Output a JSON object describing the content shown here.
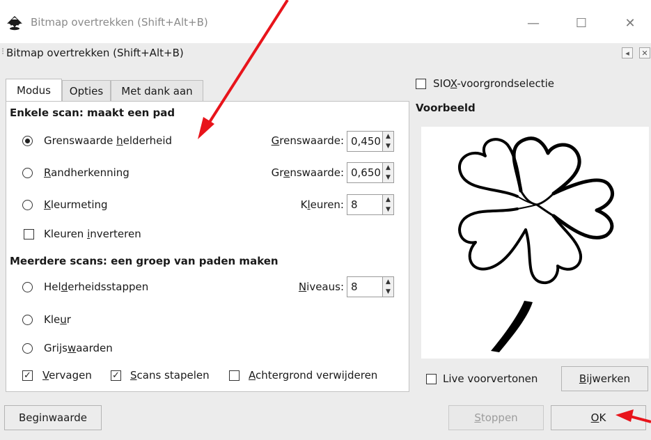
{
  "window": {
    "title": "Bitmap overtrekken (Shift+Alt+B)",
    "minimize_glyph": "—",
    "maximize_glyph": "☐",
    "close_glyph": "✕"
  },
  "dock": {
    "grip_glyph": "⁝",
    "title": "Bitmap overtrekken (Shift+Alt+B)",
    "iconify_glyph": "◂",
    "close_glyph": "✕"
  },
  "tabs": [
    {
      "label": "Modus",
      "active": true
    },
    {
      "label": "Opties",
      "active": false
    },
    {
      "label": "Met dank aan",
      "active": false
    }
  ],
  "single_scan": {
    "title": "Enkele scan: maakt een pad",
    "options": [
      {
        "pre": "Grenswaarde ",
        "u": "h",
        "post": "elderheid",
        "selected": true,
        "spin_pre": "",
        "spin_u": "G",
        "spin_post": "renswaarde:",
        "value": "0,450"
      },
      {
        "pre": "",
        "u": "R",
        "post": "andherkenning",
        "selected": false,
        "spin_pre": "Gr",
        "spin_u": "e",
        "spin_post": "nswaarde:",
        "value": "0,650"
      },
      {
        "pre": "",
        "u": "K",
        "post": "leurmeting",
        "selected": false,
        "spin_pre": "K",
        "spin_u": "l",
        "spin_post": "euren:",
        "value": "8"
      }
    ],
    "invert": {
      "pre": "Kleuren ",
      "u": "i",
      "post": "nverteren",
      "checked": false
    }
  },
  "multi_scan": {
    "title": "Meerdere scans: een groep van paden maken",
    "options": [
      {
        "pre": "Hel",
        "u": "d",
        "post": "erheidsstappen",
        "selected": false,
        "spin_pre": "",
        "spin_u": "N",
        "spin_post": "iveaus:",
        "value": "8"
      },
      {
        "pre": "Kle",
        "u": "u",
        "post": "r",
        "selected": false
      },
      {
        "pre": "Grijs",
        "u": "w",
        "post": "aarden",
        "selected": false
      }
    ],
    "checks": [
      {
        "pre": "",
        "u": "V",
        "post": "ervagen",
        "checked": true
      },
      {
        "pre": "",
        "u": "S",
        "post": "cans stapelen",
        "checked": true
      },
      {
        "pre": "",
        "u": "A",
        "post": "chtergrond verwijderen",
        "checked": false
      }
    ]
  },
  "right": {
    "siox": {
      "pre": "SIO",
      "u": "X",
      "post": "-voorgrondselectie",
      "checked": false
    },
    "preview_title": "Voorbeeld",
    "live_label": "Live voorvertonen",
    "live_checked": false,
    "update": {
      "u": "B",
      "post": "ijwerken"
    }
  },
  "bottom": {
    "reset_label": "Beginwaarde",
    "stop": {
      "u": "S",
      "post": "toppen"
    },
    "ok": {
      "u": "O",
      "post": "K"
    }
  },
  "colors": {
    "annotation_arrow": "#e8141b",
    "panel_bg": "#ececec"
  }
}
